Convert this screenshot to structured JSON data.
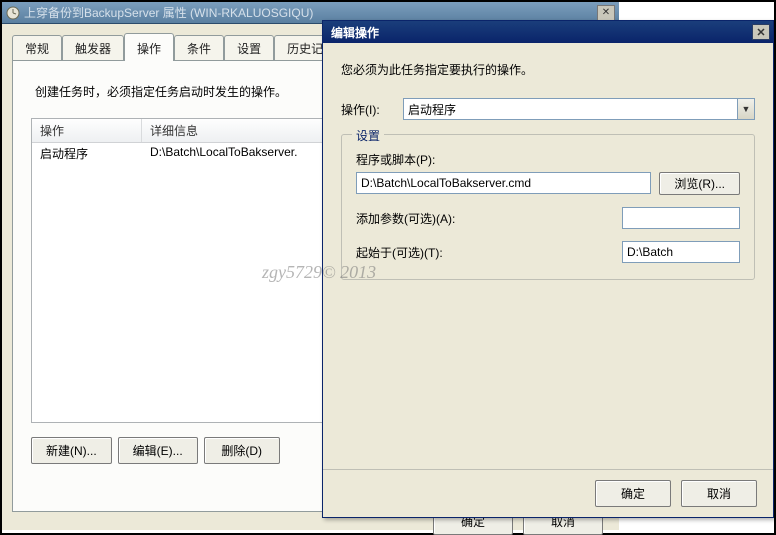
{
  "main_window": {
    "title": "上穿备份到BackupServer 属性 (WIN-RKALUOSGIQU)",
    "tabs": [
      "常规",
      "触发器",
      "操作",
      "条件",
      "设置",
      "历史记录"
    ],
    "active_tab_index": 2,
    "hint": "创建任务时，必须指定任务启动时发生的操作。",
    "list": {
      "columns": [
        "操作",
        "详细信息"
      ],
      "rows": [
        {
          "action": "启动程序",
          "detail": "D:\\Batch\\LocalToBakserver."
        }
      ]
    },
    "buttons": {
      "new": "新建(N)...",
      "edit": "编辑(E)...",
      "delete": "删除(D)"
    },
    "bg_buttons": {
      "ok": "确定",
      "cancel": "取消"
    }
  },
  "dialog": {
    "title": "编辑操作",
    "instruction": "您必须为此任务指定要执行的操作。",
    "action_label": "操作(I):",
    "action_value": "启动程序",
    "groupbox_legend": "设置",
    "script_label": "程序或脚本(P):",
    "script_value": "D:\\Batch\\LocalToBakserver.cmd",
    "browse": "浏览(R)...",
    "args_label": "添加参数(可选)(A):",
    "args_value": "",
    "startin_label": "起始于(可选)(T):",
    "startin_value": "D:\\Batch",
    "ok": "确定",
    "cancel": "取消"
  },
  "watermark": "zgy5729© 2013"
}
